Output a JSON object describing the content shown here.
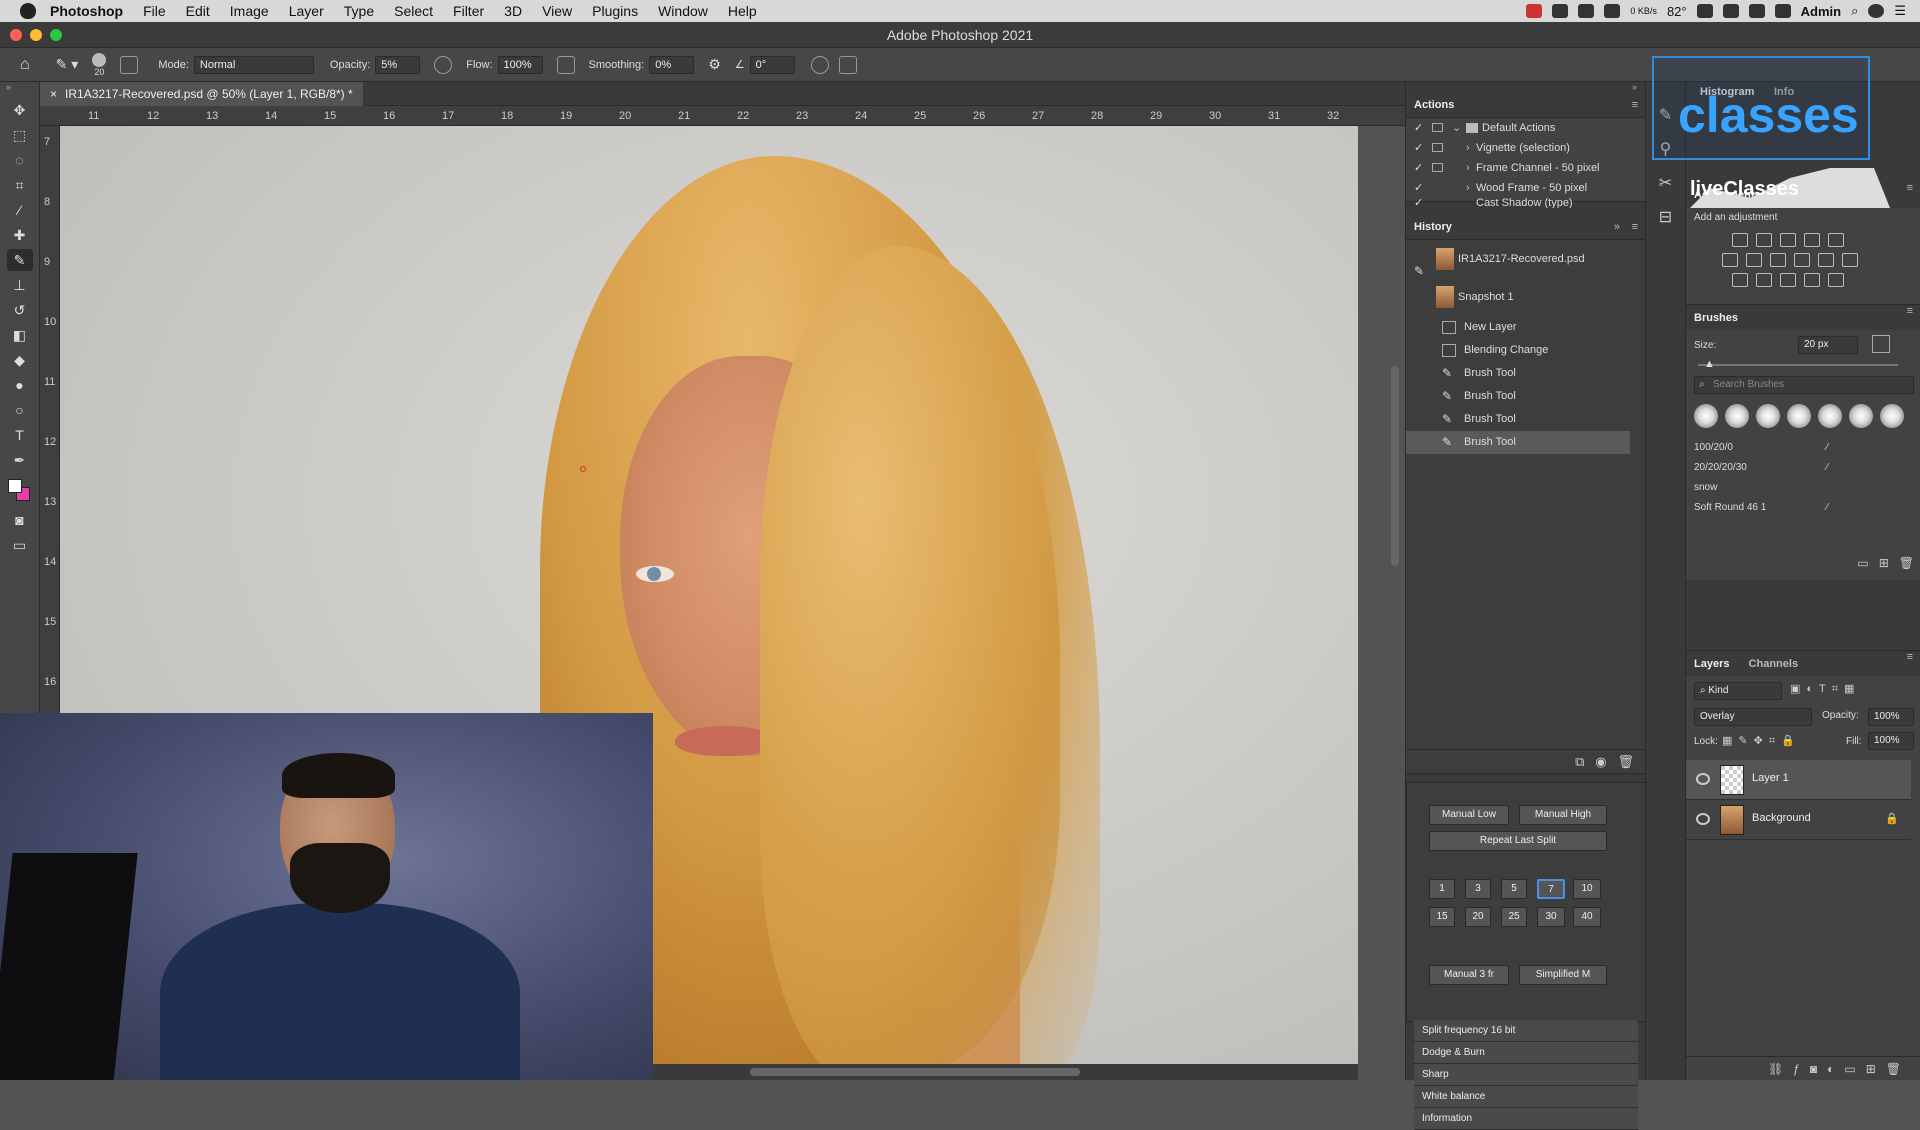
{
  "menubar": {
    "app": "Photoshop",
    "items": [
      "File",
      "Edit",
      "Image",
      "Layer",
      "Type",
      "Select",
      "Filter",
      "3D",
      "View",
      "Plugins",
      "Window",
      "Help"
    ],
    "temperature": "82°",
    "net_speed": "0 KB/s",
    "user": "Admin"
  },
  "window": {
    "title": "Adobe Photoshop 2021"
  },
  "options": {
    "brush_size": "20",
    "mode_label": "Mode:",
    "mode_value": "Normal",
    "opacity_label": "Opacity:",
    "opacity_value": "5%",
    "flow_label": "Flow:",
    "flow_value": "100%",
    "smoothing_label": "Smoothing:",
    "smoothing_value": "0%",
    "angle_value": "0°"
  },
  "document": {
    "tab_title": "IR1A3217-Recovered.psd @ 50% (Layer 1, RGB/8*) *"
  },
  "ruler": {
    "h_ticks": [
      "11",
      "12",
      "13",
      "14",
      "15",
      "16",
      "17",
      "18",
      "19",
      "20",
      "21",
      "22",
      "23",
      "24",
      "25",
      "26",
      "27",
      "28",
      "29",
      "30",
      "31",
      "32"
    ],
    "v_ticks": [
      "7",
      "8",
      "9",
      "10",
      "11",
      "12",
      "13",
      "14",
      "15",
      "16"
    ]
  },
  "actions": {
    "title": "Actions",
    "items": [
      {
        "label": "Default Actions",
        "is_set": true
      },
      {
        "label": "Vignette (selection)"
      },
      {
        "label": "Frame Channel - 50 pixel"
      },
      {
        "label": "Wood Frame - 50 pixel"
      },
      {
        "label": "Cast Shadow (type)"
      }
    ]
  },
  "history": {
    "title": "History",
    "snapshots": [
      "IR1A3217-Recovered.psd",
      "Snapshot 1"
    ],
    "steps": [
      "New Layer",
      "Blending Change",
      "Brush Tool",
      "Brush Tool",
      "Brush Tool",
      "Brush Tool"
    ]
  },
  "plugin": {
    "buttons_top": [
      "Manual Low",
      "Manual High"
    ],
    "repeat": "Repeat Last Split",
    "nums_row1": [
      "1",
      "3",
      "5",
      "7",
      "10"
    ],
    "nums_row2": [
      "15",
      "20",
      "25",
      "30",
      "40"
    ],
    "selected_num": "7",
    "buttons_bottom": [
      "Manual 3 fr",
      "Simplified M"
    ],
    "stack": [
      "Split frequency 16 bit",
      "Dodge & Burn",
      "Sharp",
      "White balance",
      "Information"
    ]
  },
  "right": {
    "histogram_tabs": [
      "Histogram",
      "Info"
    ],
    "logo_text": "classes",
    "logo_sub": "liveClasses",
    "adjustments_title": "Adjustments",
    "adjustments_hint": "Add an adjustment",
    "brushes_title": "Brushes",
    "size_label": "Size:",
    "size_value": "20 px",
    "search_placeholder": "Search Brushes",
    "brush_presets": [
      "100/20/0",
      "20/20/20/30",
      "snow",
      "Soft Round 46 1"
    ],
    "layers_tabs": [
      "Layers",
      "Channels"
    ],
    "kind_label": "Kind",
    "blend_mode": "Overlay",
    "opacity_label": "Opacity:",
    "opacity_value": "100%",
    "lock_label": "Lock:",
    "fill_label": "Fill:",
    "fill_value": "100%",
    "layers": [
      "Layer 1",
      "Background"
    ]
  },
  "colors": {
    "accent": "#2e8fe0",
    "panel_bg": "#424242",
    "app_bg": "#535353"
  }
}
